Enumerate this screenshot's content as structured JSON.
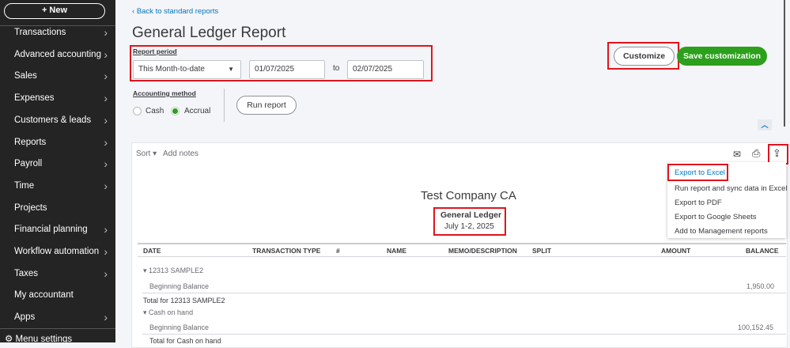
{
  "sidebar": {
    "new_label": "+   New",
    "items": [
      {
        "label": "Transactions",
        "chevron": true
      },
      {
        "label": "Advanced accounting",
        "chevron": true
      },
      {
        "label": "Sales",
        "chevron": true
      },
      {
        "label": "Expenses",
        "chevron": true
      },
      {
        "label": "Customers & leads",
        "chevron": true
      },
      {
        "label": "Reports",
        "chevron": true
      },
      {
        "label": "Payroll",
        "chevron": true
      },
      {
        "label": "Time",
        "chevron": true
      },
      {
        "label": "Projects",
        "chevron": false
      },
      {
        "label": "Financial planning",
        "chevron": true
      },
      {
        "label": "Workflow automation",
        "chevron": true
      },
      {
        "label": "Taxes",
        "chevron": true
      },
      {
        "label": "My accountant",
        "chevron": false
      },
      {
        "label": "Apps",
        "chevron": true
      }
    ],
    "menu_settings": "Menu settings"
  },
  "header": {
    "back_link": "Back to standard reports",
    "title": "General Ledger Report"
  },
  "filters": {
    "report_period_label": "Report period",
    "period": "This Month-to-date",
    "from": "01/07/2025",
    "to_label": "to",
    "to": "02/07/2025",
    "method_label": "Accounting method",
    "cash": "Cash",
    "accrual": "Accrual",
    "selected_method": "Accrual",
    "run_report": "Run report"
  },
  "actions": {
    "customize": "Customize",
    "save_customization": "Save customization"
  },
  "toolbar": {
    "sort": "Sort",
    "add_notes": "Add notes"
  },
  "export_menu": [
    "Export to Excel",
    "Run report and sync data in Excel",
    "Export to PDF",
    "Export to Google Sheets",
    "Add to Management reports"
  ],
  "report": {
    "company": "Test Company CA",
    "name": "General Ledger",
    "dates": "July 1-2, 2025",
    "columns": [
      "DATE",
      "TRANSACTION TYPE",
      "#",
      "NAME",
      "MEMO/DESCRIPTION",
      "SPLIT",
      "AMOUNT",
      "BALANCE"
    ],
    "rows": [
      {
        "text": "12313 SAMPLE2",
        "kind": "group"
      },
      {
        "text": "Beginning Balance",
        "balance": "1,950.00",
        "kind": "row"
      },
      {
        "text": "Total for 12313 SAMPLE2",
        "kind": "total"
      },
      {
        "text": "Cash on hand",
        "kind": "group"
      },
      {
        "text": "Beginning Balance",
        "balance": "100,152.45",
        "kind": "row"
      },
      {
        "text": "Total for Cash on hand",
        "kind": "total"
      }
    ]
  },
  "colors": {
    "accent_green": "#2ca01c",
    "link_blue": "#0077c5",
    "highlight_red": "#e0141e",
    "sidebar_bg": "#242424"
  }
}
